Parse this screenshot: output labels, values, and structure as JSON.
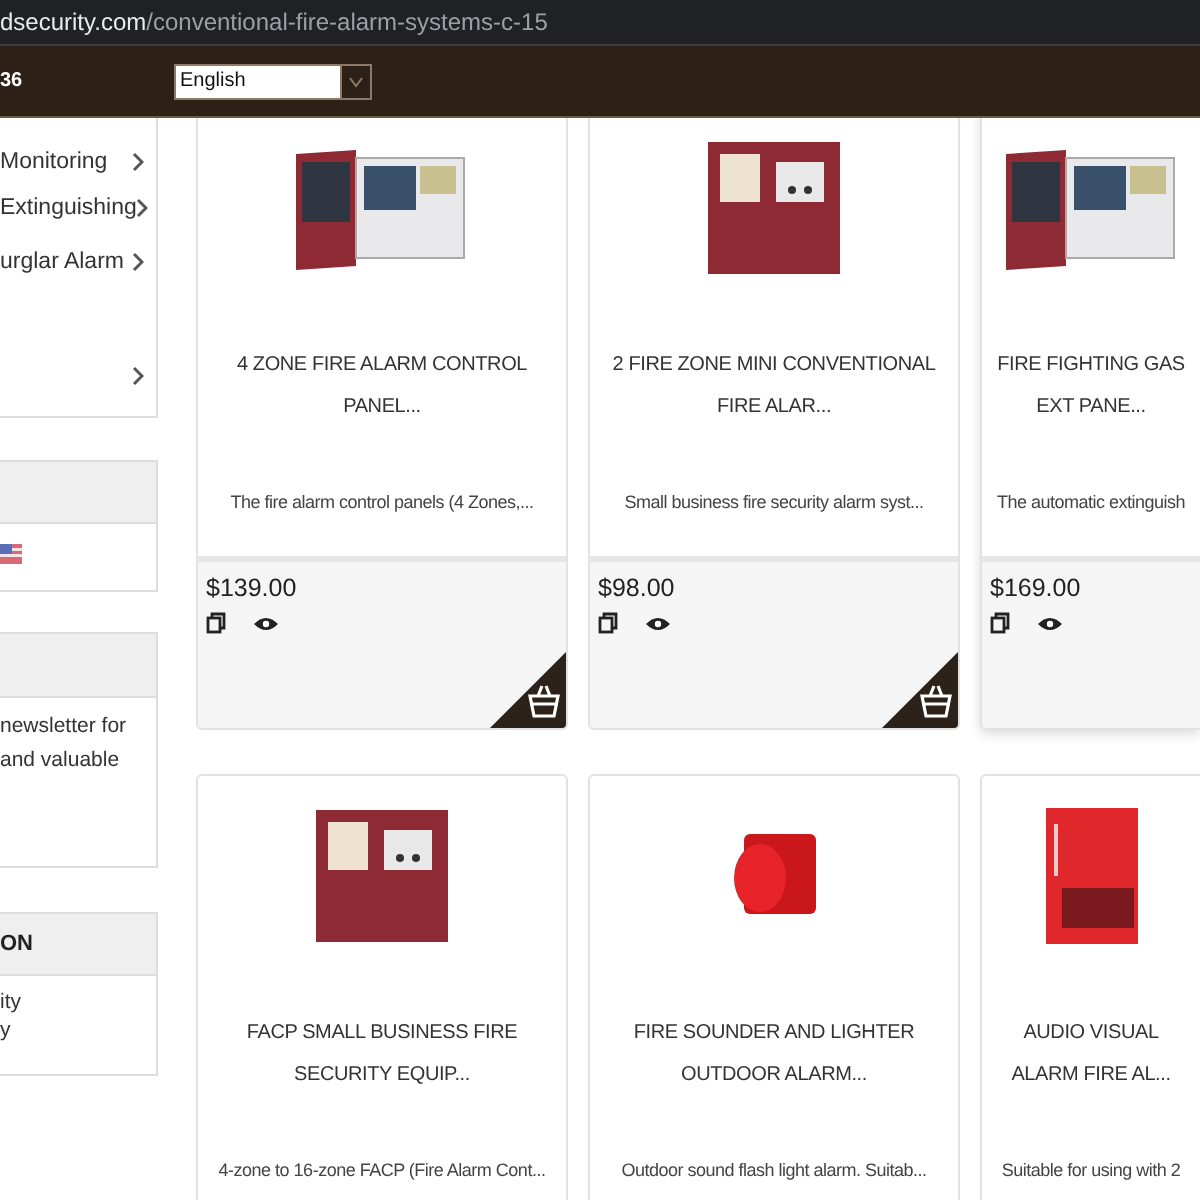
{
  "address_bar": {
    "domain": "dsecurity.com",
    "path": "/conventional-fire-alarm-systems-c-15"
  },
  "header": {
    "phone_fragment": "36",
    "language_select": {
      "value": "English"
    }
  },
  "sidebar": {
    "categories": [
      {
        "label": "Monitoring"
      },
      {
        "label": "Extinguishing"
      },
      {
        "label": "urglar Alarm"
      }
    ],
    "newsletter": {
      "lines": [
        "newsletter for",
        "and valuable"
      ]
    },
    "information": {
      "heading": "ON",
      "links": [
        "ity",
        "y"
      ]
    }
  },
  "products": [
    {
      "title": "4 ZONE FIRE ALARM CONTROL PANEL...",
      "description": "The fire alarm control panels (4 Zones,...",
      "price": "$139.00",
      "kind": "open-panel",
      "cart": true
    },
    {
      "title": "2 FIRE ZONE MINI CONVENTIONAL FIRE ALAR...",
      "description": "Small business fire security alarm syst...",
      "price": "$98.00",
      "kind": "closed-panel",
      "cart": true
    },
    {
      "title": "FIRE FIGHTING GAS EXT PANE...",
      "description": "The automatic extinguish",
      "price": "$169.00",
      "kind": "open-panel",
      "cart": false
    },
    {
      "title": "FACP SMALL BUSINESS FIRE SECURITY EQUIP...",
      "description": "4-zone to 16-zone FACP (Fire Alarm Cont...",
      "kind": "closed-panel"
    },
    {
      "title": "FIRE SOUNDER AND LIGHTER OUTDOOR ALARM...",
      "description": "Outdoor sound flash light alarm. Suitab...",
      "kind": "sounder"
    },
    {
      "title": "AUDIO VISUAL ALARM FIRE AL...",
      "description": "Suitable for using with 2",
      "kind": "strobe"
    }
  ]
}
